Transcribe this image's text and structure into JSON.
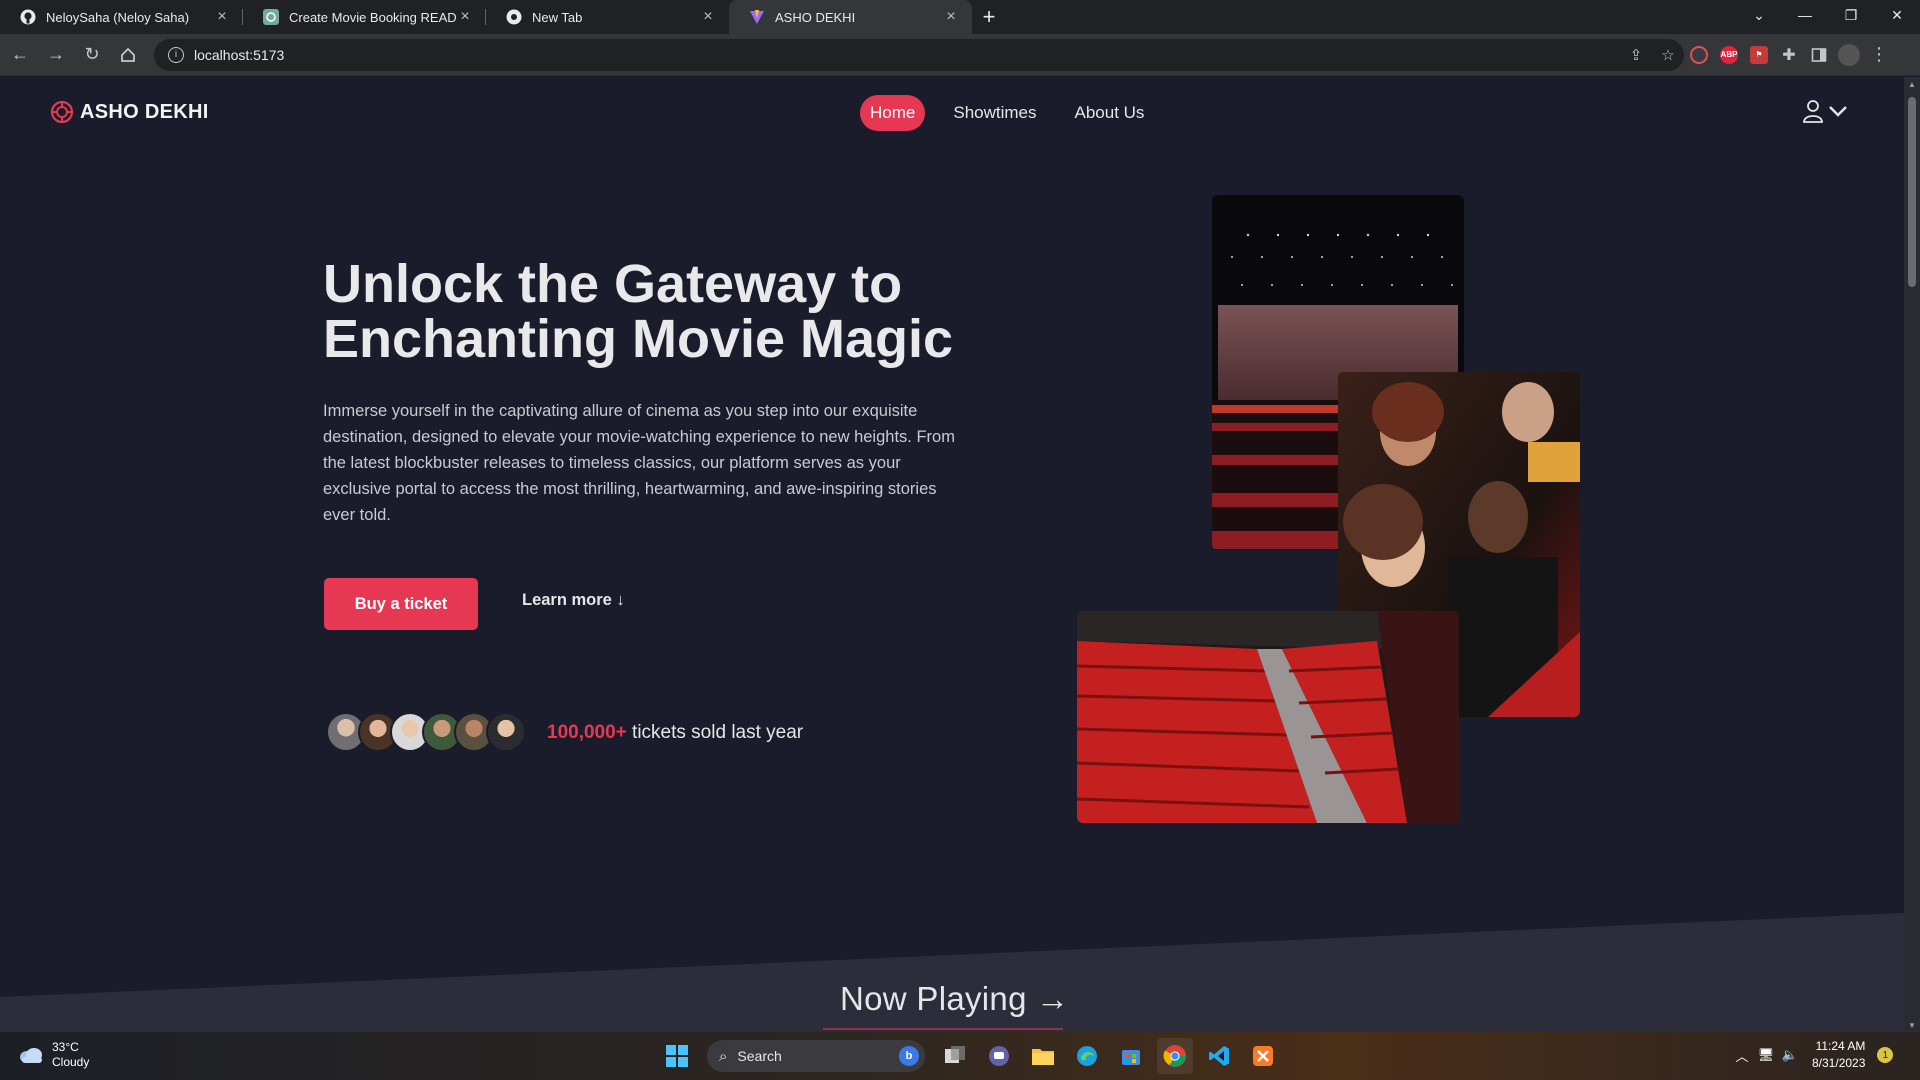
{
  "browser": {
    "tabs": [
      {
        "title": "NeloySaha (Neloy Saha)",
        "icon": "github-icon",
        "active": false
      },
      {
        "title": "Create Movie Booking README",
        "icon": "chatgpt-icon",
        "active": false
      },
      {
        "title": "New Tab",
        "icon": "chrome-icon",
        "active": false
      },
      {
        "title": "ASHO DEKHI",
        "icon": "vite-icon",
        "active": true
      }
    ],
    "address": "localhost:5173",
    "extensions": [
      "record-icon",
      "adblock-icon",
      "extension-red-icon",
      "puzzle-icon",
      "sidepanel-icon",
      "profile-icon"
    ]
  },
  "site": {
    "brand": "ASHO DEKHI",
    "nav": [
      {
        "label": "Home",
        "active": true
      },
      {
        "label": "Showtimes",
        "active": false
      },
      {
        "label": "About Us",
        "active": false
      }
    ],
    "hero": {
      "title_line1": "Unlock the Gateway to",
      "title_line2": "Enchanting Movie Magic",
      "description": "Immerse yourself in the captivating allure of cinema as you step into our exquisite destination, designed to elevate your movie-watching experience to new heights. From the latest blockbuster releases to timeless classics, our platform serves as your exclusive portal to access the most thrilling, heartwarming, and awe-inspiring stories ever told.",
      "buy_label": "Buy a ticket",
      "learn_label": "Learn more ↓",
      "sold_count": "100,000+",
      "sold_text": " tickets sold last year"
    },
    "section_title": "Now Playing →",
    "colors": {
      "accent": "#e63852",
      "background": "#1b1c2b",
      "lower": "#2b2d3b"
    }
  },
  "taskbar": {
    "weather_temp": "33°C",
    "weather_desc": "Cloudy",
    "search_placeholder": "Search",
    "time": "11:24 AM",
    "date": "8/31/2023",
    "notifications": "1"
  }
}
